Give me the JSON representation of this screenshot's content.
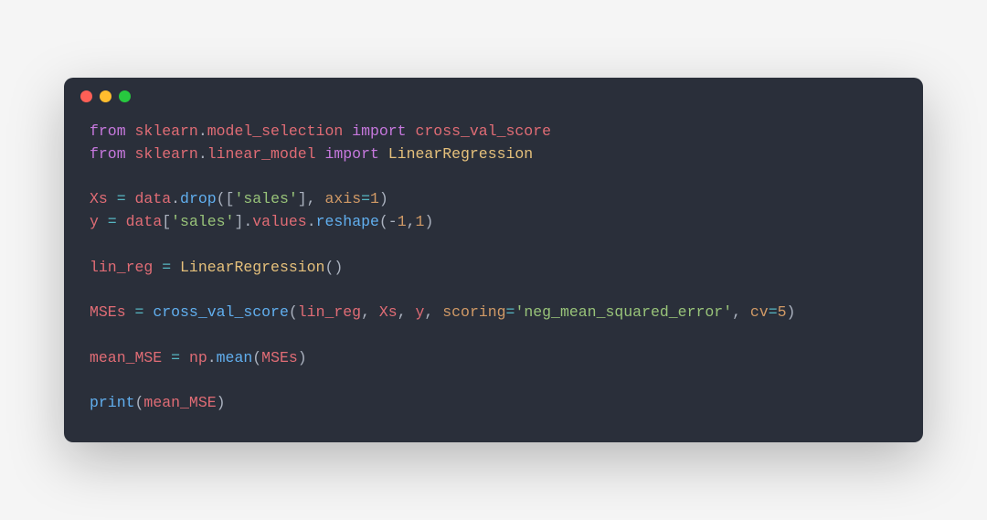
{
  "window": {
    "traffic_lights": [
      "close",
      "minimize",
      "maximize"
    ]
  },
  "code": {
    "lines": [
      [
        {
          "t": "from ",
          "c": "kw"
        },
        {
          "t": "sklearn",
          "c": "mod"
        },
        {
          "t": ".",
          "c": "pun"
        },
        {
          "t": "model_selection",
          "c": "mod"
        },
        {
          "t": " import ",
          "c": "kw"
        },
        {
          "t": "cross_val_score",
          "c": "mod"
        }
      ],
      [
        {
          "t": "from ",
          "c": "kw"
        },
        {
          "t": "sklearn",
          "c": "mod"
        },
        {
          "t": ".",
          "c": "pun"
        },
        {
          "t": "linear_model",
          "c": "mod"
        },
        {
          "t": " import ",
          "c": "kw"
        },
        {
          "t": "LinearRegression",
          "c": "cls"
        }
      ],
      [],
      [
        {
          "t": "Xs",
          "c": "var"
        },
        {
          "t": " = ",
          "c": "op"
        },
        {
          "t": "data",
          "c": "var"
        },
        {
          "t": ".",
          "c": "pun"
        },
        {
          "t": "drop",
          "c": "fn"
        },
        {
          "t": "([",
          "c": "pun"
        },
        {
          "t": "'sales'",
          "c": "str"
        },
        {
          "t": "], ",
          "c": "pun"
        },
        {
          "t": "axis",
          "c": "kwarg"
        },
        {
          "t": "=",
          "c": "op"
        },
        {
          "t": "1",
          "c": "num"
        },
        {
          "t": ")",
          "c": "pun"
        }
      ],
      [
        {
          "t": "y",
          "c": "var"
        },
        {
          "t": " = ",
          "c": "op"
        },
        {
          "t": "data",
          "c": "var"
        },
        {
          "t": "[",
          "c": "pun"
        },
        {
          "t": "'sales'",
          "c": "str"
        },
        {
          "t": "]",
          "c": "pun"
        },
        {
          "t": ".",
          "c": "pun"
        },
        {
          "t": "values",
          "c": "var"
        },
        {
          "t": ".",
          "c": "pun"
        },
        {
          "t": "reshape",
          "c": "fn"
        },
        {
          "t": "(-",
          "c": "pun"
        },
        {
          "t": "1",
          "c": "num"
        },
        {
          "t": ",",
          "c": "pun"
        },
        {
          "t": "1",
          "c": "num"
        },
        {
          "t": ")",
          "c": "pun"
        }
      ],
      [],
      [
        {
          "t": "lin_reg",
          "c": "var"
        },
        {
          "t": " = ",
          "c": "op"
        },
        {
          "t": "LinearRegression",
          "c": "cls"
        },
        {
          "t": "()",
          "c": "pun"
        }
      ],
      [],
      [
        {
          "t": "MSEs",
          "c": "var"
        },
        {
          "t": " = ",
          "c": "op"
        },
        {
          "t": "cross_val_score",
          "c": "fn"
        },
        {
          "t": "(",
          "c": "pun"
        },
        {
          "t": "lin_reg",
          "c": "var"
        },
        {
          "t": ", ",
          "c": "pun"
        },
        {
          "t": "Xs",
          "c": "var"
        },
        {
          "t": ", ",
          "c": "pun"
        },
        {
          "t": "y",
          "c": "var"
        },
        {
          "t": ", ",
          "c": "pun"
        },
        {
          "t": "scoring",
          "c": "kwarg"
        },
        {
          "t": "=",
          "c": "op"
        },
        {
          "t": "'neg_mean_squared_error'",
          "c": "str"
        },
        {
          "t": ", ",
          "c": "pun"
        },
        {
          "t": "cv",
          "c": "kwarg"
        },
        {
          "t": "=",
          "c": "op"
        },
        {
          "t": "5",
          "c": "num"
        },
        {
          "t": ")",
          "c": "pun"
        }
      ],
      [],
      [
        {
          "t": "mean_MSE",
          "c": "var"
        },
        {
          "t": " = ",
          "c": "op"
        },
        {
          "t": "np",
          "c": "var"
        },
        {
          "t": ".",
          "c": "pun"
        },
        {
          "t": "mean",
          "c": "fn"
        },
        {
          "t": "(",
          "c": "pun"
        },
        {
          "t": "MSEs",
          "c": "var"
        },
        {
          "t": ")",
          "c": "pun"
        }
      ],
      [],
      [
        {
          "t": "print",
          "c": "fn"
        },
        {
          "t": "(",
          "c": "pun"
        },
        {
          "t": "mean_MSE",
          "c": "var"
        },
        {
          "t": ")",
          "c": "pun"
        }
      ]
    ]
  }
}
